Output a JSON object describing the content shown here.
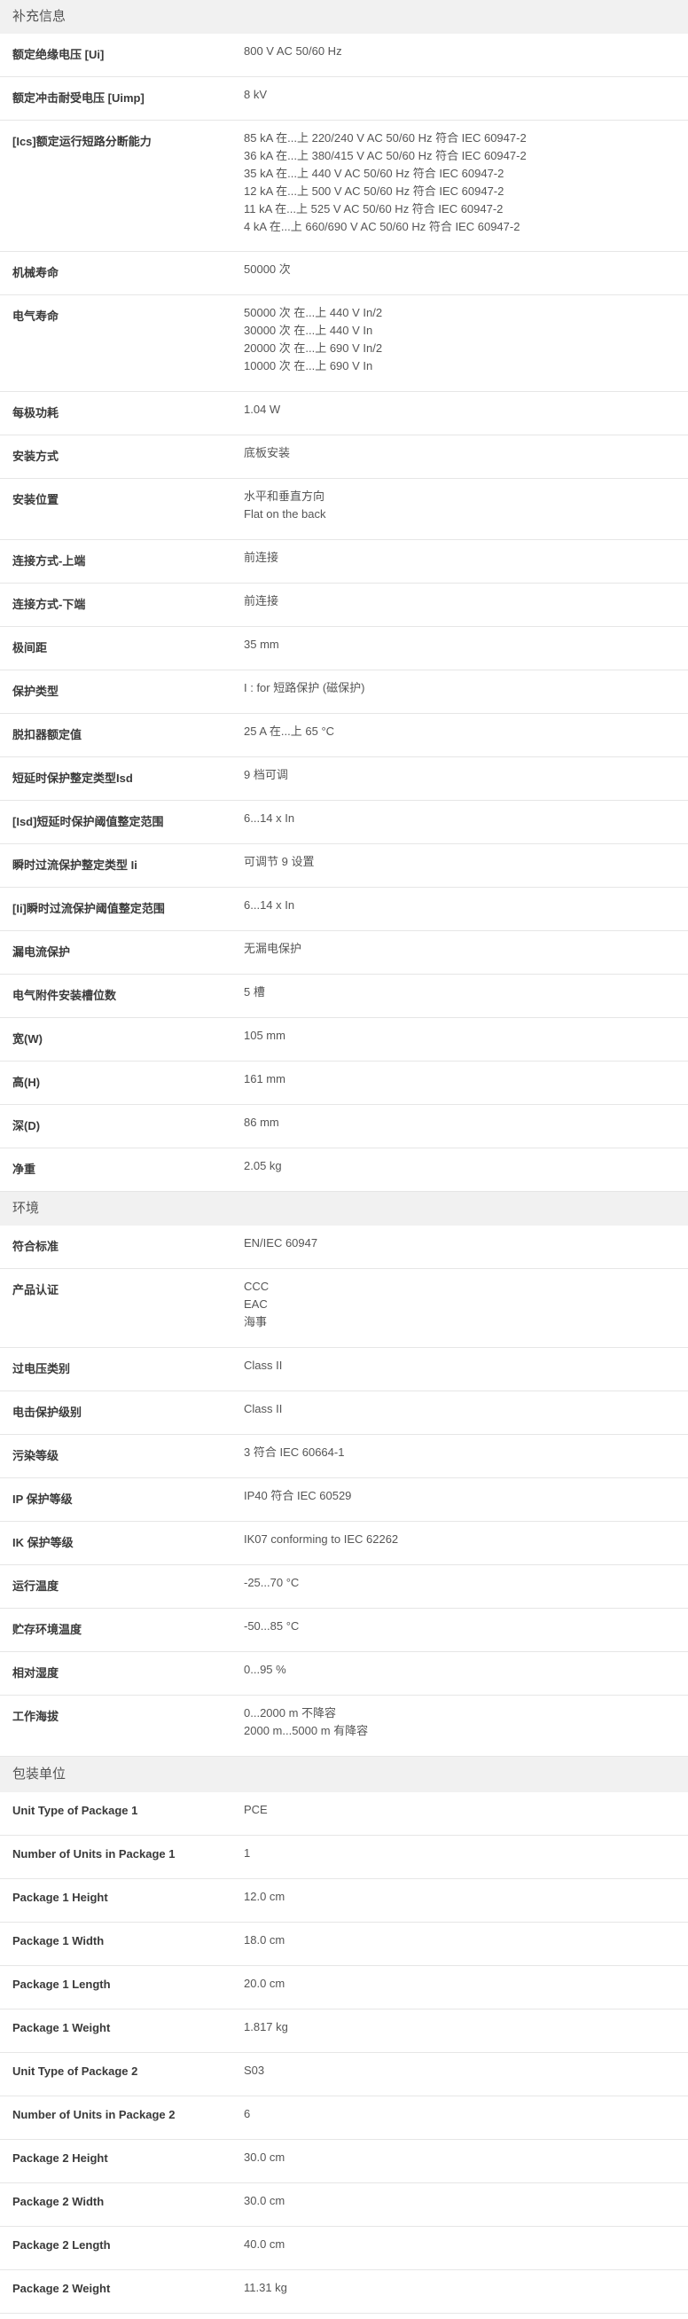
{
  "sections": [
    {
      "title": "补充信息",
      "rows": [
        {
          "label": "额定绝缘电压 [Ui]",
          "values": [
            "800 V AC 50/60 Hz"
          ]
        },
        {
          "label": "额定冲击耐受电压 [Uimp]",
          "values": [
            "8 kV"
          ]
        },
        {
          "label": "[Ics]额定运行短路分断能力",
          "values": [
            "85 kA 在...上 220/240 V AC 50/60 Hz 符合 IEC 60947-2",
            "36 kA 在...上 380/415 V AC 50/60 Hz 符合 IEC 60947-2",
            "35 kA 在...上 440 V AC 50/60 Hz 符合 IEC 60947-2",
            "12 kA 在...上 500 V AC 50/60 Hz 符合 IEC 60947-2",
            "11 kA 在...上 525 V AC 50/60 Hz 符合 IEC 60947-2",
            "4 kA 在...上 660/690 V AC 50/60 Hz 符合 IEC 60947-2"
          ]
        },
        {
          "label": "机械寿命",
          "values": [
            "50000 次"
          ]
        },
        {
          "label": "电气寿命",
          "values": [
            "50000 次 在...上 440 V In/2",
            "30000 次 在...上 440 V In",
            "20000 次 在...上 690 V In/2",
            "10000 次 在...上 690 V In"
          ]
        },
        {
          "label": "每极功耗",
          "values": [
            "1.04 W"
          ]
        },
        {
          "label": "安装方式",
          "values": [
            "底板安装"
          ]
        },
        {
          "label": "安装位置",
          "values": [
            "水平和垂直方向",
            "Flat on the back"
          ]
        },
        {
          "label": "连接方式-上端",
          "values": [
            "前连接"
          ]
        },
        {
          "label": "连接方式-下端",
          "values": [
            "前连接"
          ]
        },
        {
          "label": "极间距",
          "values": [
            "35 mm"
          ]
        },
        {
          "label": "保护类型",
          "values": [
            "I : for 短路保护 (磁保护)"
          ]
        },
        {
          "label": "脱扣器额定值",
          "values": [
            "25 A 在...上 65 °C"
          ]
        },
        {
          "label": "短延时保护整定类型Isd",
          "values": [
            "9 档可调"
          ]
        },
        {
          "label": "[Isd]短延时保护阈值整定范围",
          "values": [
            "6...14 x In"
          ]
        },
        {
          "label": "瞬时过流保护整定类型 Ii",
          "values": [
            "可调节 9 设置"
          ]
        },
        {
          "label": "[Ii]瞬时过流保护阈值整定范围",
          "values": [
            "6...14 x In"
          ]
        },
        {
          "label": "漏电流保护",
          "values": [
            "无漏电保护"
          ]
        },
        {
          "label": "电气附件安装槽位数",
          "values": [
            "5 槽"
          ]
        },
        {
          "label": "宽(W)",
          "values": [
            "105 mm"
          ]
        },
        {
          "label": "高(H)",
          "values": [
            "161 mm"
          ]
        },
        {
          "label": "深(D)",
          "values": [
            "86 mm"
          ]
        },
        {
          "label": "净重",
          "values": [
            "2.05 kg"
          ]
        }
      ]
    },
    {
      "title": "环境",
      "rows": [
        {
          "label": "符合标准",
          "values": [
            "EN/IEC 60947"
          ]
        },
        {
          "label": "产品认证",
          "values": [
            "CCC",
            "EAC",
            "海事"
          ]
        },
        {
          "label": "过电压类别",
          "values": [
            "Class II"
          ]
        },
        {
          "label": "电击保护级别",
          "values": [
            "Class II"
          ]
        },
        {
          "label": "污染等级",
          "values": [
            "3 符合 IEC 60664-1"
          ]
        },
        {
          "label": "IP 保护等级",
          "values": [
            "IP40 符合 IEC 60529"
          ]
        },
        {
          "label": "IK 保护等级",
          "values": [
            "IK07 conforming to IEC 62262"
          ]
        },
        {
          "label": "运行温度",
          "values": [
            "-25...70 °C"
          ]
        },
        {
          "label": "贮存环境温度",
          "values": [
            "-50...85 °C"
          ]
        },
        {
          "label": "相对湿度",
          "values": [
            "0...95 %"
          ]
        },
        {
          "label": "工作海拔",
          "values": [
            "0...2000 m 不降容",
            "2000 m...5000 m 有降容"
          ]
        }
      ]
    },
    {
      "title": "包装单位",
      "rows": [
        {
          "label": "Unit Type of Package 1",
          "values": [
            "PCE"
          ]
        },
        {
          "label": "Number of Units in Package 1",
          "values": [
            "1"
          ]
        },
        {
          "label": "Package 1 Height",
          "values": [
            "12.0 cm"
          ]
        },
        {
          "label": "Package 1 Width",
          "values": [
            "18.0 cm"
          ]
        },
        {
          "label": "Package 1 Length",
          "values": [
            "20.0 cm"
          ]
        },
        {
          "label": "Package 1 Weight",
          "values": [
            "1.817 kg"
          ]
        },
        {
          "label": "Unit Type of Package 2",
          "values": [
            "S03"
          ]
        },
        {
          "label": "Number of Units in Package 2",
          "values": [
            "6"
          ]
        },
        {
          "label": "Package 2 Height",
          "values": [
            "30.0 cm"
          ]
        },
        {
          "label": "Package 2 Width",
          "values": [
            "30.0 cm"
          ]
        },
        {
          "label": "Package 2 Length",
          "values": [
            "40.0 cm"
          ]
        },
        {
          "label": "Package 2 Weight",
          "values": [
            "11.31 kg"
          ]
        }
      ]
    }
  ]
}
